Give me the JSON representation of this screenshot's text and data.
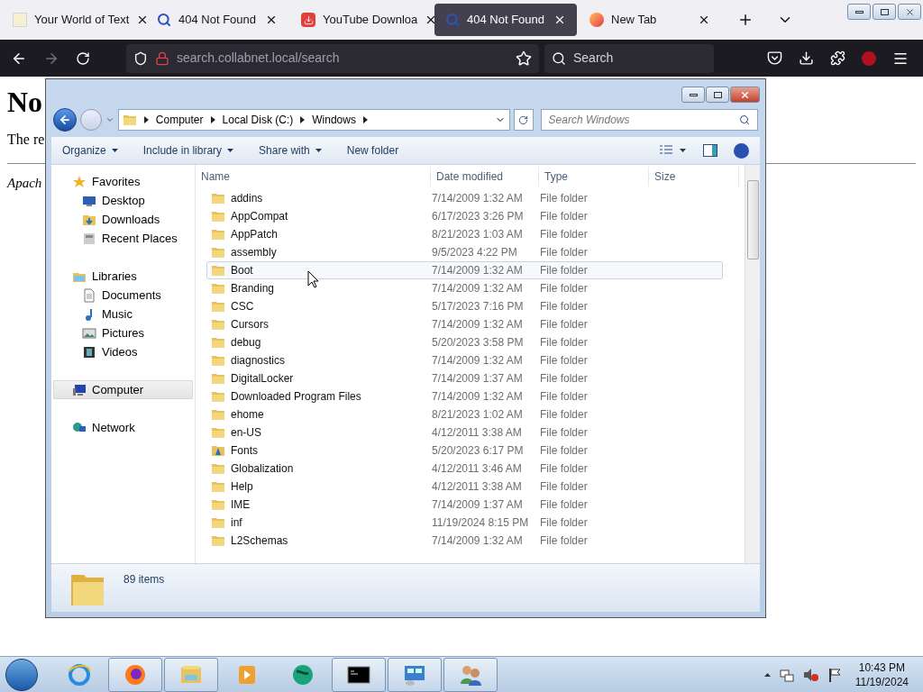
{
  "browser": {
    "tabs": [
      {
        "title": "Your World of Text",
        "kind": "text",
        "selected": false
      },
      {
        "title": "404 Not Found",
        "kind": "search",
        "selected": false
      },
      {
        "title": "YouTube Downloa",
        "kind": "download",
        "selected": false
      },
      {
        "title": "404 Not Found",
        "kind": "search",
        "selected": true
      },
      {
        "title": "New Tab",
        "kind": "firefox",
        "selected": false
      }
    ],
    "url_host": "search.collabnet.local",
    "url_path": "/search",
    "search_placeholder": "Search"
  },
  "page": {
    "heading": "No",
    "paragraph": "The re",
    "footer": "Apach"
  },
  "explorer": {
    "breadcrumb": [
      "Computer",
      "Local Disk (C:)",
      "Windows"
    ],
    "search_placeholder": "Search Windows",
    "toolbar": [
      "Organize",
      "Include in library",
      "Share with",
      "New folder"
    ],
    "nav": [
      {
        "label": "Favorites",
        "kind": "star",
        "children": [
          {
            "label": "Desktop",
            "kind": "desktop",
            "selected": false
          },
          {
            "label": "Downloads",
            "kind": "downloads",
            "selected": false
          },
          {
            "label": "Recent Places",
            "kind": "recent",
            "selected": false
          }
        ],
        "selected": false
      },
      {
        "label": "Libraries",
        "kind": "library",
        "children": [
          {
            "label": "Documents",
            "kind": "documents",
            "selected": false
          },
          {
            "label": "Music",
            "kind": "music",
            "selected": false
          },
          {
            "label": "Pictures",
            "kind": "pictures",
            "selected": false
          },
          {
            "label": "Videos",
            "kind": "videos",
            "selected": false
          }
        ],
        "selected": false
      },
      {
        "label": "Computer",
        "kind": "computer",
        "selected": true
      },
      {
        "label": "Network",
        "kind": "network",
        "selected": false
      }
    ],
    "columns": [
      "Name",
      "Date modified",
      "Type",
      "Size"
    ],
    "rows": [
      {
        "name": "addins",
        "date": "7/14/2009 1:32 AM",
        "type": "File folder",
        "kind": "folder",
        "hovered": false
      },
      {
        "name": "AppCompat",
        "date": "6/17/2023 3:26 PM",
        "type": "File folder",
        "kind": "folder",
        "hovered": false
      },
      {
        "name": "AppPatch",
        "date": "8/21/2023 1:03 AM",
        "type": "File folder",
        "kind": "folder",
        "hovered": false
      },
      {
        "name": "assembly",
        "date": "9/5/2023 4:22 PM",
        "type": "File folder",
        "kind": "folder",
        "hovered": false
      },
      {
        "name": "Boot",
        "date": "7/14/2009 1:32 AM",
        "type": "File folder",
        "kind": "folder",
        "hovered": true
      },
      {
        "name": "Branding",
        "date": "7/14/2009 1:32 AM",
        "type": "File folder",
        "kind": "folder",
        "hovered": false
      },
      {
        "name": "CSC",
        "date": "5/17/2023 7:16 PM",
        "type": "File folder",
        "kind": "folder",
        "hovered": false
      },
      {
        "name": "Cursors",
        "date": "7/14/2009 1:32 AM",
        "type": "File folder",
        "kind": "folder",
        "hovered": false
      },
      {
        "name": "debug",
        "date": "5/20/2023 3:58 PM",
        "type": "File folder",
        "kind": "folder",
        "hovered": false
      },
      {
        "name": "diagnostics",
        "date": "7/14/2009 1:32 AM",
        "type": "File folder",
        "kind": "folder",
        "hovered": false
      },
      {
        "name": "DigitalLocker",
        "date": "7/14/2009 1:37 AM",
        "type": "File folder",
        "kind": "folder",
        "hovered": false
      },
      {
        "name": "Downloaded Program Files",
        "date": "7/14/2009 1:32 AM",
        "type": "File folder",
        "kind": "folder",
        "hovered": false
      },
      {
        "name": "ehome",
        "date": "8/21/2023 1:02 AM",
        "type": "File folder",
        "kind": "folder",
        "hovered": false
      },
      {
        "name": "en-US",
        "date": "4/12/2011 3:38 AM",
        "type": "File folder",
        "kind": "folder",
        "hovered": false
      },
      {
        "name": "Fonts",
        "date": "5/20/2023 6:17 PM",
        "type": "File folder",
        "kind": "fonts",
        "hovered": false
      },
      {
        "name": "Globalization",
        "date": "4/12/2011 3:46 AM",
        "type": "File folder",
        "kind": "folder",
        "hovered": false
      },
      {
        "name": "Help",
        "date": "4/12/2011 3:38 AM",
        "type": "File folder",
        "kind": "folder",
        "hovered": false
      },
      {
        "name": "IME",
        "date": "7/14/2009 1:37 AM",
        "type": "File folder",
        "kind": "folder",
        "hovered": false
      },
      {
        "name": "inf",
        "date": "11/19/2024 8:15 PM",
        "type": "File folder",
        "kind": "folder",
        "hovered": false
      },
      {
        "name": "L2Schemas",
        "date": "7/14/2009 1:32 AM",
        "type": "File folder",
        "kind": "folder",
        "hovered": false
      }
    ],
    "item_count": "89 items"
  },
  "taskbar": {
    "apps": [
      {
        "kind": "ie",
        "running": false
      },
      {
        "kind": "firefox",
        "running": true
      },
      {
        "kind": "explorer",
        "running": true
      },
      {
        "kind": "media",
        "running": false
      },
      {
        "kind": "globe",
        "running": false
      },
      {
        "kind": "cmd",
        "running": true
      },
      {
        "kind": "control",
        "running": true
      },
      {
        "kind": "users",
        "running": true
      }
    ],
    "time": "10:43 PM",
    "date": "11/19/2024"
  }
}
